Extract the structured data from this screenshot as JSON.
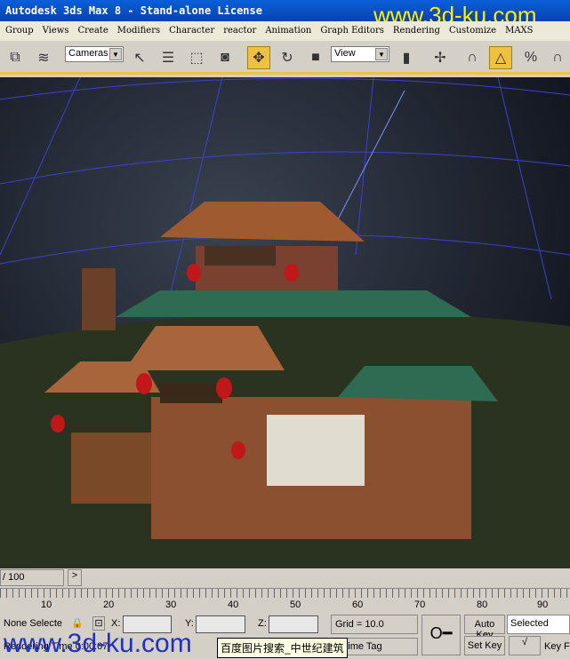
{
  "title": "Autodesk 3ds Max 8  - Stand-alone License",
  "watermark": "www.3d-ku.com",
  "menu": [
    "Group",
    "Views",
    "Create",
    "Modifiers",
    "Character",
    "reactor",
    "Animation",
    "Graph Editors",
    "Rendering",
    "Customize",
    "MAXS"
  ],
  "toolbar": {
    "selection_filter": "Cameras",
    "reference_coord": "View"
  },
  "timeline": {
    "frame": "/ 100",
    "next": ">",
    "ticks": [
      "10",
      "20",
      "30",
      "40",
      "50",
      "60",
      "70",
      "80",
      "90"
    ]
  },
  "status": {
    "selection": "None Selecte",
    "x_label": "X:",
    "y_label": "Y:",
    "z_label": "Z:",
    "grid": "Grid = 10.0",
    "auto_key": "Auto Key",
    "selected": "Selected",
    "set_key": "Set Key",
    "key_filters": "Key F",
    "prompt": "Rendering Time 0:00:07",
    "time_tag": "d Time Tag",
    "tooltip": "百度图片搜索_中世纪建筑"
  },
  "colors": {
    "title_bar": "#0a5fd8",
    "active_tool": "#f0c040",
    "watermark_yellow": "#ffee00",
    "watermark_blue": "#2030c0"
  }
}
